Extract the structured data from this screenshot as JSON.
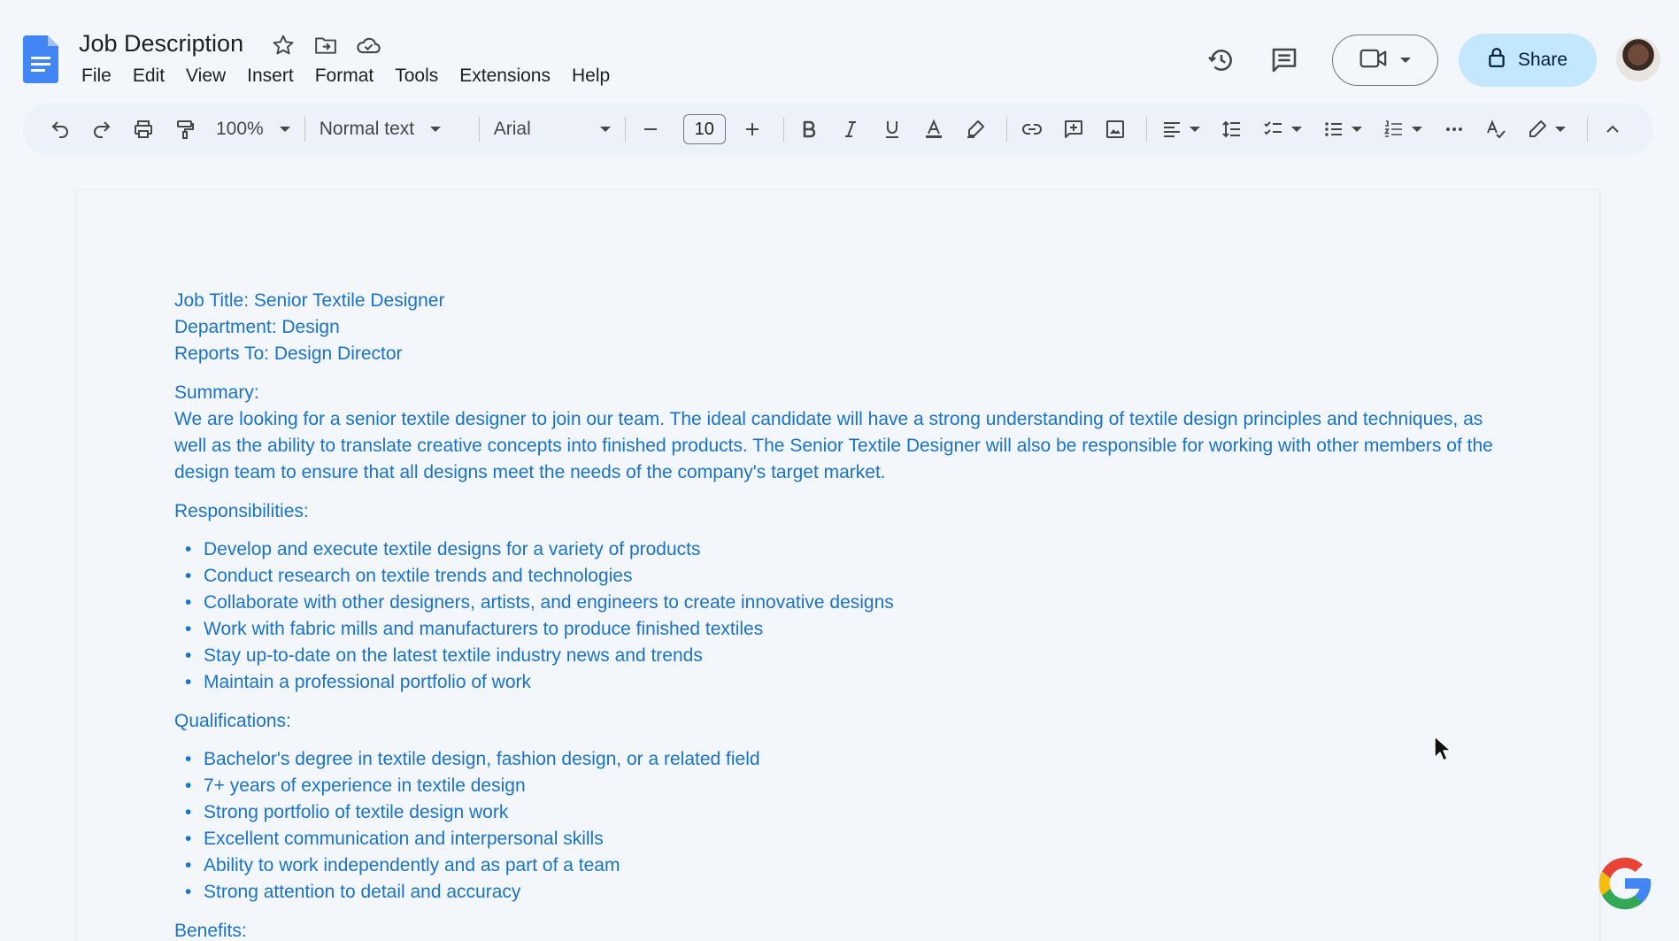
{
  "app": {
    "doc_title": "Job Description",
    "menu": [
      "File",
      "Edit",
      "View",
      "Insert",
      "Format",
      "Tools",
      "Extensions",
      "Help"
    ],
    "share_label": "Share"
  },
  "toolbar": {
    "zoom": "100%",
    "style": "Normal text",
    "font": "Arial",
    "font_size": "10"
  },
  "document": {
    "header_lines": [
      "Job Title: Senior Textile Designer",
      "Department: Design",
      "Reports To: Design Director"
    ],
    "summary_heading": "Summary:",
    "summary_text": "We are looking for a senior textile designer to join our team. The ideal candidate will have a strong understanding of textile design principles and techniques, as well as the ability to translate creative concepts into finished products. The Senior Textile Designer will also be responsible for working with other members of the design team to ensure that all designs meet the needs of the company's target market.",
    "responsibilities_heading": "Responsibilities:",
    "responsibilities": [
      "Develop and execute textile designs for a variety of products",
      "Conduct research on textile trends and technologies",
      "Collaborate with other designers, artists, and engineers to create innovative designs",
      "Work with fabric mills and manufacturers to produce finished textiles",
      "Stay up-to-date on the latest textile industry news and trends",
      "Maintain a professional portfolio of work"
    ],
    "qualifications_heading": "Qualifications:",
    "qualifications": [
      "Bachelor's degree in textile design, fashion design, or a related field",
      "7+ years of experience in textile design",
      "Strong portfolio of textile design work",
      "Excellent communication and interpersonal skills",
      "Ability to work independently and as part of a team",
      "Strong attention to detail and accuracy"
    ],
    "benefits_heading": "Benefits:"
  },
  "colors": {
    "doc_text": "#1a73c7",
    "share_bg": "#c2e7ff",
    "toolbar_bg": "#edf2fa"
  }
}
